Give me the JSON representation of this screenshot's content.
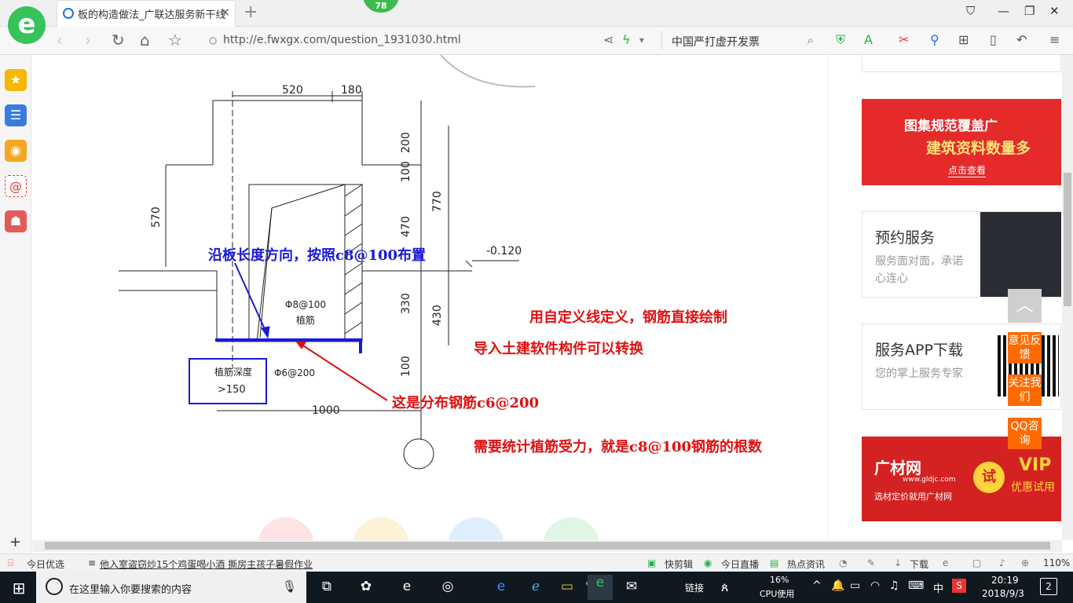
{
  "browser": {
    "tab_title": "板的构造做法_广联达服务新干线",
    "badge_count": "78",
    "url": "http://e.fwxgx.com/question_1931030.html",
    "search_text": "中国严打虚开发票"
  },
  "drawing": {
    "dims": {
      "d520": "520",
      "d180": "180",
      "d200": "200",
      "d100a": "100",
      "d770": "770",
      "d570": "570",
      "d470": "470",
      "d330": "330",
      "d430": "430",
      "d100b": "100",
      "d1000": "1000",
      "level": "-0.120"
    },
    "labels": {
      "phi8": "Φ8@100",
      "zhijin": "植筋",
      "phi6": "Φ6@200",
      "depth_line1": "植筋深度",
      "depth_line2": ">150"
    },
    "annotations": {
      "blue": "沿板长度方向，按照c8@100布置",
      "red1": "用自定义线定义，钢筋直接绘制",
      "red2": "导入土建软件构件可以转换",
      "red3": "这是分布钢筋c6@200",
      "red4": "需要统计植筋受力，就是c8@100钢筋的根数"
    }
  },
  "right": {
    "ad1_line1": "图集规范覆盖广",
    "ad1_line2": "建筑资料数量多",
    "ad1_button": "点击查看",
    "card1_title": "预约服务",
    "card1_desc": "服务面对面，承诺心连心",
    "card2_title": "服务APP下载",
    "card2_desc": "您的掌上服务专家",
    "ad2_brand": "广材网",
    "ad2_url": "www.gldjc.com",
    "ad2_slogan": "选材定价就用广材网",
    "ad2_try": "试",
    "ad2_vip": "VIP",
    "ad2_vip_sub": "优惠试用",
    "float_feedback": "意见反馈",
    "float_follow": "关注我们",
    "float_qq": "QQ咨询"
  },
  "statusbar": {
    "today": "今日优选",
    "news": "他入室盗窃炒15个鸡蛋喝小酒 撕房主孩子暑假作业",
    "kuaijian": "快剪辑",
    "live": "今日直播",
    "hot": "热点资讯",
    "download": "下载",
    "zoom": "110%"
  },
  "taskbar": {
    "search_placeholder": "在这里输入你要搜索的内容",
    "link": "链接",
    "cpu_percent": "16%",
    "cpu_label": "CPU使用",
    "ime": "中",
    "time": "20:19",
    "date": "2018/9/3",
    "notifications": "2"
  },
  "colors": {
    "accent_green": "#35c35a",
    "annotation_blue": "#1a1ad6",
    "annotation_red": "#e01010",
    "float_orange": "#ff6a00"
  }
}
